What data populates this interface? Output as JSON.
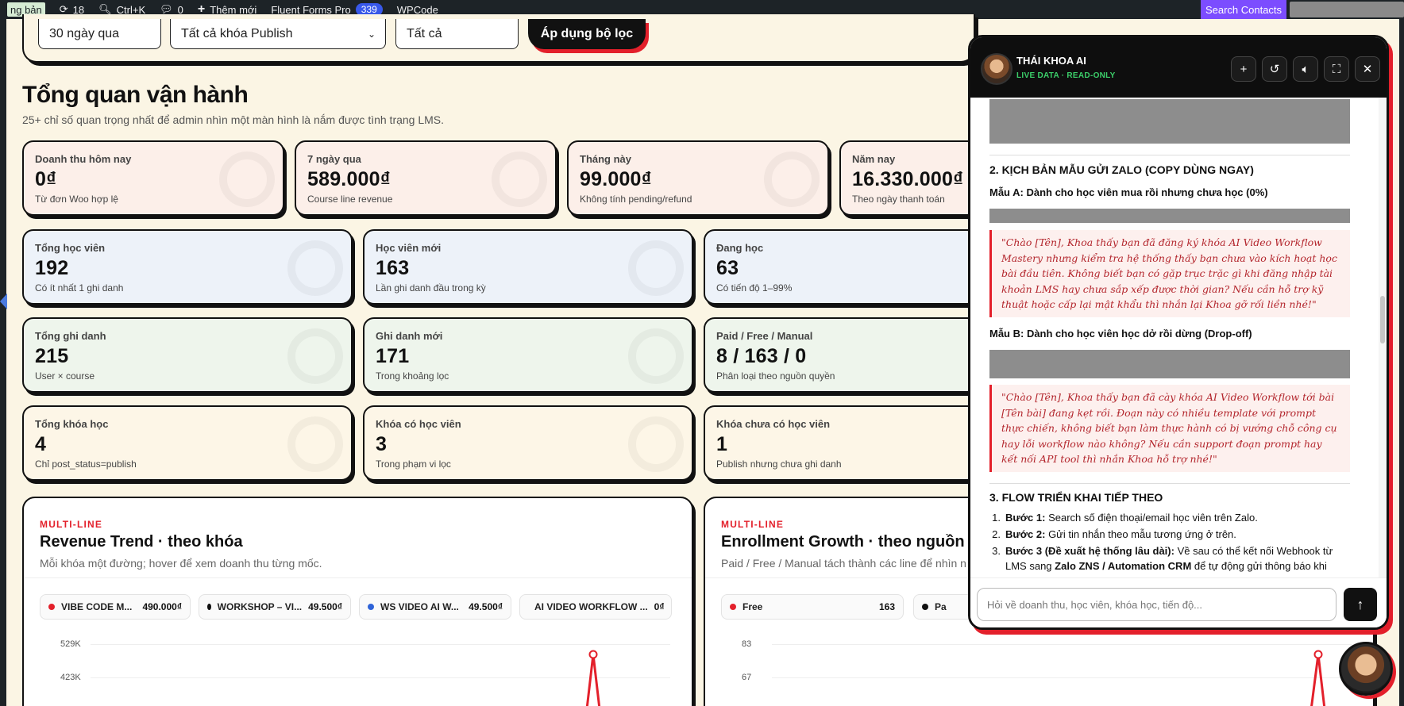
{
  "adminbar": {
    "site_label": "ng bản",
    "updates_count": "18",
    "search_shortcut": "Ctrl+K",
    "comments_count": "0",
    "new_label": "Thêm mới",
    "fluent_label": "Fluent Forms Pro",
    "fluent_badge": "339",
    "wpcode_label": "WPCode",
    "search_contacts": "Search Contacts"
  },
  "filters": {
    "range": "30 ngày qua",
    "course": "Tất cả khóa Publish",
    "status": "Tất cả",
    "apply": "Áp dụng bộ lọc"
  },
  "overview": {
    "title": "Tổng quan vận hành",
    "subtitle": "25+ chỉ số quan trọng nhất để admin nhìn một màn hình là nắm được tình trạng LMS."
  },
  "revenue_cards": [
    {
      "label": "Doanh thu hôm nay",
      "value": "0₫",
      "sub": "Từ đơn Woo hợp lệ"
    },
    {
      "label": "7 ngày qua",
      "value": "589.000₫",
      "sub": "Course line revenue"
    },
    {
      "label": "Tháng này",
      "value": "99.000₫",
      "sub": "Không tính pending/refund"
    },
    {
      "label": "Năm nay",
      "value": "16.330.000₫",
      "sub": "Theo ngày thanh toán"
    }
  ],
  "students_cards": [
    {
      "label": "Tổng học viên",
      "value": "192",
      "sub": "Có ít nhất 1 ghi danh"
    },
    {
      "label": "Học viên mới",
      "value": "163",
      "sub": "Lần ghi danh đầu trong kỳ"
    },
    {
      "label": "Đang học",
      "value": "63",
      "sub": "Có tiến độ 1–99%"
    }
  ],
  "enroll_cards": [
    {
      "label": "Tổng ghi danh",
      "value": "215",
      "sub": "User × course"
    },
    {
      "label": "Ghi danh mới",
      "value": "171",
      "sub": "Trong khoảng lọc"
    },
    {
      "label": "Paid / Free / Manual",
      "value": "8 / 163 / 0",
      "sub": "Phân loại theo nguồn quyền"
    }
  ],
  "course_cards": [
    {
      "label": "Tổng khóa học",
      "value": "4",
      "sub": "Chỉ post_status=publish"
    },
    {
      "label": "Khóa có học viên",
      "value": "3",
      "sub": "Trong phạm vi lọc"
    },
    {
      "label": "Khóa chưa có học viên",
      "value": "1",
      "sub": "Publish nhưng chưa ghi danh"
    }
  ],
  "revenue_chart": {
    "kicker": "MULTI-LINE",
    "title": "Revenue Trend · theo khóa",
    "subtitle": "Mỗi khóa một đường; hover để xem doanh thu từng mốc.",
    "legend": [
      {
        "name": "VIBE CODE M...",
        "value": "490.000₫",
        "color": "#e3202b"
      },
      {
        "name": "WORKSHOP – VI...",
        "value": "49.500₫",
        "color": "#111111"
      },
      {
        "name": "WS VIDEO AI W...",
        "value": "49.500₫",
        "color": "#2f63d8"
      },
      {
        "name": "AI VIDEO WORKFLOW ...",
        "value": "0₫",
        "color": "#177245"
      }
    ],
    "yticks": [
      "529K",
      "423K"
    ]
  },
  "enroll_chart": {
    "kicker": "MULTI-LINE",
    "title": "Enrollment Growth · theo nguồn",
    "subtitle": "Paid / Free / Manual tách thành các line để nhìn n",
    "legend": [
      {
        "name": "Free",
        "value": "163",
        "color": "#e3202b"
      },
      {
        "name": "Pa",
        "value": "",
        "color": "#111111"
      }
    ],
    "yticks": [
      "83",
      "67"
    ]
  },
  "chart_data": [
    {
      "type": "line",
      "title": "Revenue Trend · theo khóa",
      "ylim": [
        0,
        529000
      ],
      "yticks": [
        "529K",
        "423K"
      ],
      "series": [
        {
          "name": "VIBE CODE M...",
          "peak": 490000
        }
      ]
    },
    {
      "type": "line",
      "title": "Enrollment Growth · theo nguồn",
      "ylim": [
        0,
        83
      ],
      "yticks": [
        "83",
        "67"
      ],
      "series": [
        {
          "name": "Free",
          "peak": 80
        }
      ]
    }
  ],
  "chat": {
    "name": "THÁI KHOA AI",
    "status": "LIVE DATA · READ-ONLY",
    "section2": "2. KỊCH BẢN MẪU GỬI ZALO (COPY DÙNG NGAY)",
    "templateA": "Mẫu A: Dành cho học viên mua rồi nhưng chưa học (0%)",
    "quoteA": "\"Chào [Tên], Khoa thấy bạn đã đăng ký khóa AI Video Workflow Mastery nhưng kiểm tra hệ thống thấy bạn chưa vào kích hoạt học bài đầu tiên. Không biết bạn có gặp trục trặc gì khi đăng nhập tài khoản LMS hay chưa sắp xếp được thời gian? Nếu cần hỗ trợ kỹ thuật hoặc cấp lại mật khẩu thì nhắn lại Khoa gỡ rối liền nhé!\"",
    "templateB": "Mẫu B: Dành cho học viên học dở rồi dừng (Drop-off)",
    "quoteB": "\"Chào [Tên], Khoa thấy bạn đã cày khóa AI Video Workflow tới bài [Tên bài] đang kẹt rồi. Đoạn này có nhiều template với prompt thực chiến, không biết bạn làm thực hành có bị vướng chỗ công cụ hay lỗi workflow nào không? Nếu cần support đoạn prompt hay kết nối API tool thì nhắn Khoa hỗ trợ nhé!\"",
    "section3": "3. FLOW TRIỂN KHAI TIẾP THEO",
    "steps": [
      {
        "bold": "Bước 1:",
        "text": " Search số điện thoại/email học viên trên Zalo."
      },
      {
        "bold": "Bước 2:",
        "text": " Gửi tin nhắn theo mẫu tương ứng ở trên."
      },
      {
        "bold": "Bước 3 (Đề xuất hệ thống lâu dài):",
        "text": " Về sau có thể kết nối Webhook từ LMS sang ",
        "bold2": "Zalo ZNS / Automation CRM",
        "text2": " để tự động gửi thông báo khi"
      }
    ],
    "input_placeholder": "Hỏi về doanh thu, học viên, khóa học, tiến độ..."
  }
}
